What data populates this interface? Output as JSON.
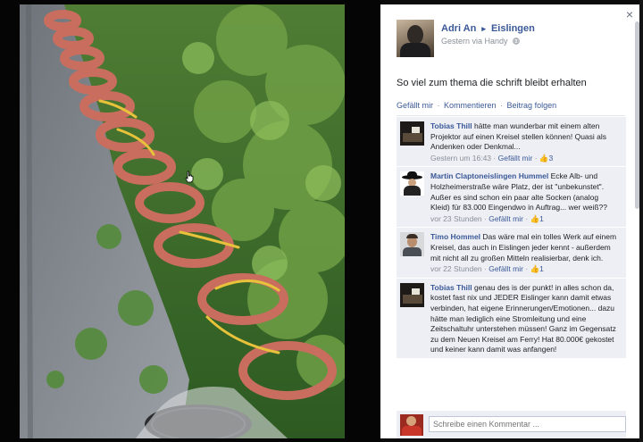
{
  "photo": {
    "alt": ""
  },
  "viewer": {
    "close_label": "×"
  },
  "post": {
    "author": "Adri An",
    "arrow": "▸",
    "target": "Eislingen",
    "time": "Gestern via Handy",
    "privacy_icon": "globe-icon",
    "text": "So viel zum thema die schrift bleibt erhalten",
    "like": "Gefällt mir",
    "comment": "Kommentieren",
    "follow": "Beitrag folgen",
    "dot": " · "
  },
  "comments": [
    {
      "name": "Tobias Thill",
      "text": "hätte man wunderbar mit einem alten Projektor auf einen Kreisel stellen können! Quasi als Andenken oder Denkmal...",
      "time": "Gestern um 16:43",
      "like": "Gefällt mir",
      "likes": "3"
    },
    {
      "name": "Martin Claptoneislingen Hummel",
      "text": "Ecke Alb- und Holzheimerstraße wäre Platz, der ist \"unbekunstet\". Außer es sind schon ein paar alte Socken (analog Kleid) für 83.000 Eingendwo in Auftrag... wer weiß??",
      "time": "vor 23 Stunden",
      "like": "Gefällt mir",
      "likes": "1"
    },
    {
      "name": "Timo Hommel",
      "text": "Das wäre mal ein tolles Werk auf einem Kreisel, das auch in Eislingen jeder kennt - außerdem mit nicht all zu großen Mitteln realisierbar, denk ich.",
      "time": "vor 22 Stunden",
      "like": "Gefällt mir",
      "likes": "1"
    },
    {
      "name": "Tobias Thill",
      "text": "genau des is der punkt! in alles schon da, kostet fast nix und JEDER Eislinger kann damit etwas verbinden, hat eigene Erinnerungen/Emotionen... dazu hätte man lediglich eine Stromleitung und eine Zeitschaltuhr unterstehen müssen! Ganz im Gegensatz zu dem Neuen Kreisel am Ferry! Hat 80.000€ gekostet und keiner kann damit was anfangen!",
      "time": "",
      "like": "",
      "likes": ""
    }
  ],
  "composer": {
    "placeholder": "Schreibe einen Kommentar ..."
  }
}
